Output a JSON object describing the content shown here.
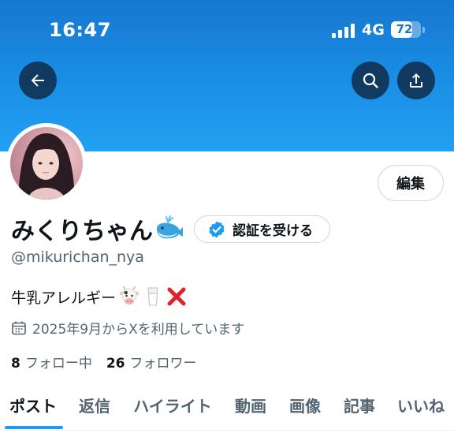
{
  "status_bar": {
    "time": "16:47",
    "network": "4G",
    "battery_level": "72",
    "battery_fraction": 0.72
  },
  "header": {
    "back_icon": "arrow-left-icon",
    "search_icon": "search-icon",
    "share_icon": "share-icon"
  },
  "profile": {
    "edit_label": "編集",
    "display_name": "みくりちゃん",
    "name_emoji": "whale-icon",
    "verify_label": "認証を受ける",
    "handle": "@mikurichan_nya",
    "bio_text": "牛乳アレルギー",
    "bio_emojis": [
      "cow-face-icon",
      "milk-glass-icon",
      "red-x-icon"
    ],
    "joined": "2025年9月からXを利用しています",
    "following_count": "8",
    "following_label": "フォロー中",
    "followers_count": "26",
    "followers_label": "フォロワー"
  },
  "tabs": [
    {
      "label": "ポスト",
      "active": true
    },
    {
      "label": "返信",
      "active": false
    },
    {
      "label": "ハイライト",
      "active": false
    },
    {
      "label": "動画",
      "active": false
    },
    {
      "label": "画像",
      "active": false
    },
    {
      "label": "記事",
      "active": false
    },
    {
      "label": "いいね",
      "active": false
    }
  ],
  "colors": {
    "banner": "#1a8fe6",
    "accent": "#1d9bf0",
    "text_primary": "#0f1419",
    "text_secondary": "#536471"
  }
}
